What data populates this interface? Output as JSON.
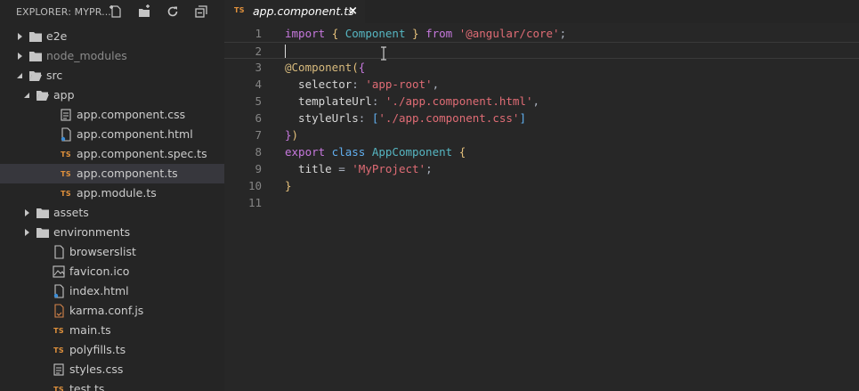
{
  "explorer": {
    "title": "EXPLORER: MYPR...",
    "actions": {
      "new_file": "new-file-icon",
      "new_folder": "new-folder-icon",
      "refresh": "refresh-icon",
      "collapse": "collapse-all-icon"
    },
    "tree": [
      {
        "label": "e2e",
        "type": "folder",
        "expanded": false
      },
      {
        "label": "node_modules",
        "type": "folder",
        "expanded": false,
        "dim": true
      },
      {
        "label": "src",
        "type": "folder",
        "expanded": true
      },
      {
        "label": "app",
        "type": "folder",
        "expanded": true
      },
      {
        "label": "app.component.css",
        "type": "css"
      },
      {
        "label": "app.component.html",
        "type": "html"
      },
      {
        "label": "app.component.spec.ts",
        "type": "ts"
      },
      {
        "label": "app.component.ts",
        "type": "ts",
        "selected": true
      },
      {
        "label": "app.module.ts",
        "type": "ts"
      },
      {
        "label": "assets",
        "type": "folder",
        "expanded": false
      },
      {
        "label": "environments",
        "type": "folder",
        "expanded": false
      },
      {
        "label": "browserslist",
        "type": "file"
      },
      {
        "label": "favicon.ico",
        "type": "image"
      },
      {
        "label": "index.html",
        "type": "html"
      },
      {
        "label": "karma.conf.js",
        "type": "js"
      },
      {
        "label": "main.ts",
        "type": "ts"
      },
      {
        "label": "polyfills.ts",
        "type": "ts"
      },
      {
        "label": "styles.css",
        "type": "css"
      },
      {
        "label": "test.ts",
        "type": "ts"
      }
    ]
  },
  "editor": {
    "tab": {
      "title": "app.component.ts",
      "icon_text": "TS",
      "close": "×"
    },
    "line_numbers": [
      "1",
      "2",
      "3",
      "4",
      "5",
      "6",
      "7",
      "8",
      "9",
      "10",
      "11"
    ],
    "lines": [
      [
        {
          "t": "import",
          "c": "kw"
        },
        {
          "t": " ",
          "c": "plain"
        },
        {
          "t": "{",
          "c": "brk"
        },
        {
          "t": " Component ",
          "c": "cls"
        },
        {
          "t": "}",
          "c": "brk"
        },
        {
          "t": " from ",
          "c": "kw"
        },
        {
          "t": "'@angular/core'",
          "c": "str"
        },
        {
          "t": ";",
          "c": "plain"
        }
      ],
      [],
      [
        {
          "t": "@Component",
          "c": "deco"
        },
        {
          "t": "(",
          "c": "brk"
        },
        {
          "t": "{",
          "c": "brk2"
        }
      ],
      [
        {
          "t": "  selector",
          "c": "prop"
        },
        {
          "t": ": ",
          "c": "plain"
        },
        {
          "t": "'app-root'",
          "c": "str"
        },
        {
          "t": ",",
          "c": "plain"
        }
      ],
      [
        {
          "t": "  templateUrl",
          "c": "prop"
        },
        {
          "t": ": ",
          "c": "plain"
        },
        {
          "t": "'./app.component.html'",
          "c": "str"
        },
        {
          "t": ",",
          "c": "plain"
        }
      ],
      [
        {
          "t": "  styleUrls",
          "c": "prop"
        },
        {
          "t": ": ",
          "c": "plain"
        },
        {
          "t": "[",
          "c": "kw2"
        },
        {
          "t": "'./app.component.css'",
          "c": "str"
        },
        {
          "t": "]",
          "c": "kw2"
        }
      ],
      [
        {
          "t": "}",
          "c": "brk2"
        },
        {
          "t": ")",
          "c": "brk"
        }
      ],
      [
        {
          "t": "export",
          "c": "kw"
        },
        {
          "t": " class ",
          "c": "kw2"
        },
        {
          "t": "AppComponent",
          "c": "cls"
        },
        {
          "t": " ",
          "c": "plain"
        },
        {
          "t": "{",
          "c": "brk"
        }
      ],
      [
        {
          "t": "  title",
          "c": "prop"
        },
        {
          "t": " = ",
          "c": "plain"
        },
        {
          "t": "'MyProject'",
          "c": "str"
        },
        {
          "t": ";",
          "c": "plain"
        }
      ],
      [
        {
          "t": "}",
          "c": "brk"
        }
      ],
      []
    ],
    "cursor_line": "2"
  },
  "colors": {
    "ts_badge": "#e0913c",
    "folder": "#c5c5c5",
    "selected_row": "#37373d"
  }
}
